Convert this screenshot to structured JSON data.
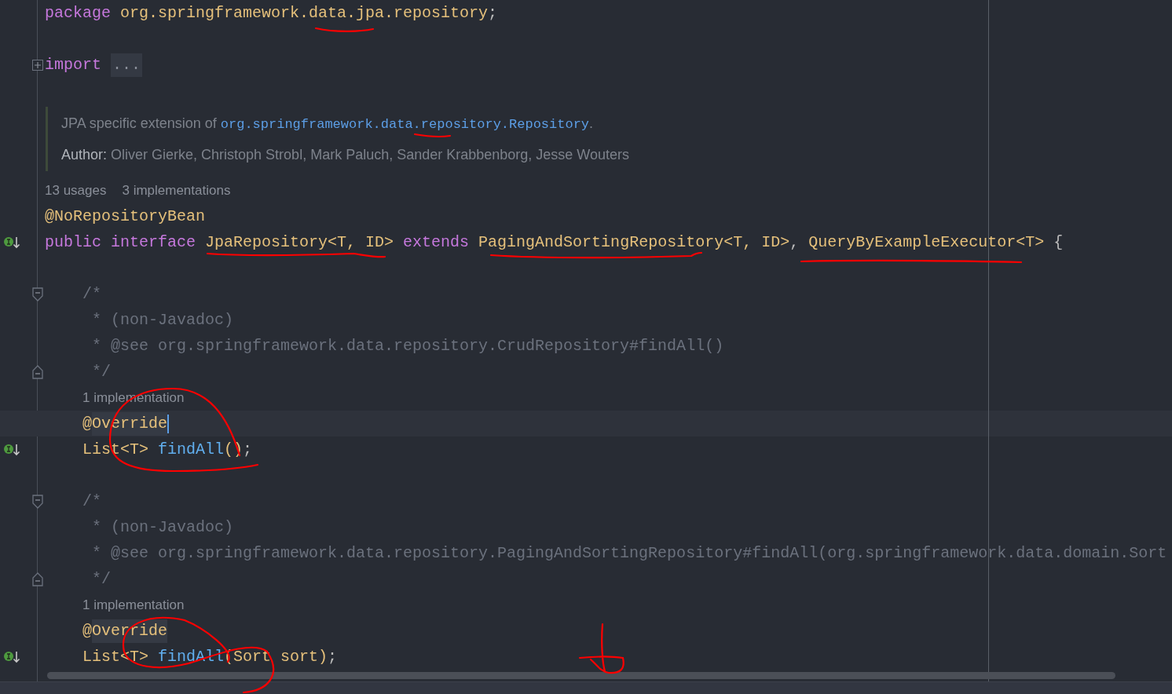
{
  "lines": [
    {
      "kind": "code",
      "indented": false,
      "current": false,
      "tokens": [
        {
          "text": "package",
          "kind": "keyword"
        },
        {
          "text": " org.springframework.data.jpa.repository",
          "kind": "type"
        },
        {
          "text": ";",
          "kind": "punct"
        }
      ]
    },
    {
      "kind": "blank"
    },
    {
      "kind": "code",
      "marker": {
        "kind": "fold-plus"
      },
      "indented": false,
      "current": false,
      "tokens": [
        {
          "text": "import",
          "kind": "keyword"
        },
        {
          "text": "...",
          "kind": "folded"
        }
      ]
    },
    {
      "kind": "blank"
    },
    {
      "kind": "doc",
      "paragraphs": [
        [
          {
            "text": "JPA specific extension of ",
            "kind": "text"
          },
          {
            "text": "org.springframework.data.repository.Repository",
            "kind": "code"
          },
          {
            "text": ".",
            "kind": "text"
          }
        ],
        [
          {
            "text": "Author:",
            "kind": "label"
          },
          {
            "text": " Oliver Gierke, Christoph Strobl, Mark Paluch, Sander Krabbenborg, Jesse Wouters",
            "kind": "text"
          }
        ]
      ]
    },
    {
      "kind": "hint",
      "indented": false,
      "items": [
        "13 usages",
        "3 implementations"
      ]
    },
    {
      "kind": "code",
      "indented": false,
      "current": false,
      "tokens": [
        {
          "text": "@NoRepositoryBean",
          "kind": "annotation"
        }
      ]
    },
    {
      "kind": "code",
      "marker": {
        "kind": "implemented"
      },
      "indented": false,
      "current": false,
      "tokens": [
        {
          "text": "public interface",
          "kind": "keyword"
        },
        {
          "text": " JpaRepository<T, ID> ",
          "kind": "type"
        },
        {
          "text": "extends",
          "kind": "keyword"
        },
        {
          "text": " PagingAndSortingRepository<T, ID>",
          "kind": "type"
        },
        {
          "text": ", ",
          "kind": "punct"
        },
        {
          "text": "QueryByExampleExecutor<T>",
          "kind": "type"
        },
        {
          "text": " {",
          "kind": "punct"
        }
      ]
    },
    {
      "kind": "blank"
    },
    {
      "kind": "code",
      "marker": {
        "kind": "fold-start"
      },
      "indented": true,
      "current": false,
      "tokens": [
        {
          "text": "/*",
          "kind": "comment"
        }
      ]
    },
    {
      "kind": "code",
      "indented": true,
      "current": false,
      "tokens": [
        {
          "text": " * (non-Javadoc)",
          "kind": "comment"
        }
      ]
    },
    {
      "kind": "code",
      "indented": true,
      "current": false,
      "tokens": [
        {
          "text": " * @see org.springframework.data.repository.CrudRepository#findAll()",
          "kind": "comment"
        }
      ]
    },
    {
      "kind": "code",
      "marker": {
        "kind": "fold-end"
      },
      "indented": true,
      "current": false,
      "tokens": [
        {
          "text": " */",
          "kind": "comment"
        }
      ]
    },
    {
      "kind": "hint",
      "indented": true,
      "items": [
        "1 implementation"
      ]
    },
    {
      "kind": "code",
      "indented": true,
      "current": true,
      "tokens": [
        {
          "text": "@",
          "kind": "annotation"
        },
        {
          "text": "Override",
          "kind": "annotation-marked"
        }
      ]
    },
    {
      "kind": "code",
      "marker": {
        "kind": "implemented"
      },
      "indented": true,
      "current": false,
      "tokens": [
        {
          "text": "List<T> ",
          "kind": "type"
        },
        {
          "text": "findAll",
          "kind": "method"
        },
        {
          "text": "()",
          "kind": "type"
        },
        {
          "text": ";",
          "kind": "punct"
        }
      ]
    },
    {
      "kind": "blank"
    },
    {
      "kind": "code",
      "marker": {
        "kind": "fold-start"
      },
      "indented": true,
      "current": false,
      "tokens": [
        {
          "text": "/*",
          "kind": "comment"
        }
      ]
    },
    {
      "kind": "code",
      "indented": true,
      "current": false,
      "tokens": [
        {
          "text": " * (non-Javadoc)",
          "kind": "comment"
        }
      ]
    },
    {
      "kind": "code",
      "indented": true,
      "current": false,
      "tokens": [
        {
          "text": " * @see org.springframework.data.repository.PagingAndSortingRepository#findAll(org.springframework.data.domain.Sort",
          "kind": "comment"
        }
      ]
    },
    {
      "kind": "code",
      "marker": {
        "kind": "fold-end"
      },
      "indented": true,
      "current": false,
      "tokens": [
        {
          "text": " */",
          "kind": "comment"
        }
      ]
    },
    {
      "kind": "hint",
      "indented": true,
      "items": [
        "1 implementation"
      ]
    },
    {
      "kind": "code",
      "indented": true,
      "current": false,
      "tokens": [
        {
          "text": "@",
          "kind": "annotation"
        },
        {
          "text": "Override",
          "kind": "annotation-marked"
        }
      ]
    },
    {
      "kind": "code",
      "marker": {
        "kind": "implemented"
      },
      "indented": true,
      "current": false,
      "tokens": [
        {
          "text": "List<T> ",
          "kind": "type"
        },
        {
          "text": "findAll",
          "kind": "method"
        },
        {
          "text": "(Sort sort)",
          "kind": "type"
        },
        {
          "text": ";",
          "kind": "punct"
        }
      ]
    }
  ]
}
